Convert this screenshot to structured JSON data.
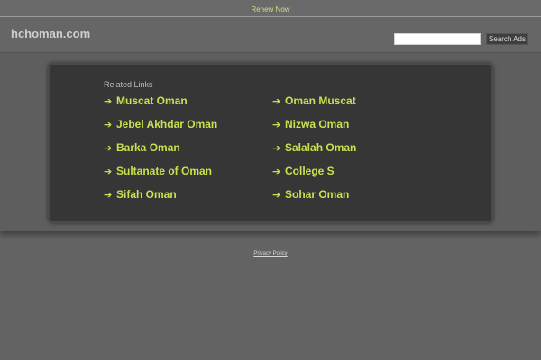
{
  "topbar": {
    "renew_label": "Renew Now"
  },
  "header": {
    "site_title": "hchoman.com",
    "search_placeholder": "",
    "search_value": "",
    "search_button_label": "Search Ads"
  },
  "related": {
    "heading": "Related Links",
    "arrow_glyph": "➔",
    "links": [
      "Muscat Oman",
      "Oman Muscat",
      "Jebel Akhdar Oman",
      "Nizwa Oman",
      "Barka Oman",
      "Salalah Oman",
      "Sultanate of Oman",
      "College S",
      "Sifah Oman",
      "Sohar Oman"
    ]
  },
  "footer": {
    "privacy_label": "Privacy Policy"
  },
  "colors": {
    "background": "#636363",
    "panel": "#363636",
    "link_accent": "#c6e24e"
  }
}
